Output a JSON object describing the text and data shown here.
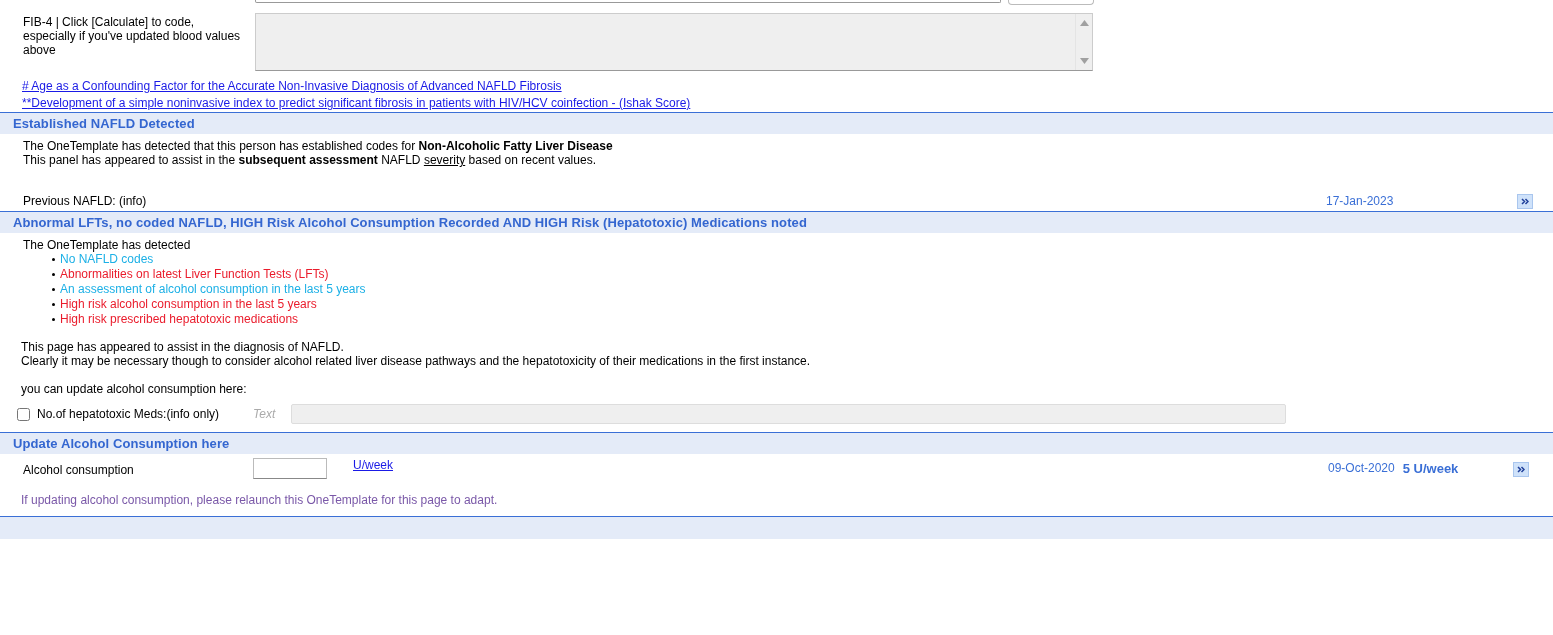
{
  "fib4": {
    "label": "FIB-4 | Click [Calculate] to code, especially if you've updated blood values above"
  },
  "references": [
    {
      "text": "# Age as a Confounding Factor for the Accurate Non-Invasive Diagnosis of Advanced NAFLD Fibrosis"
    },
    {
      "text": "**Development of a simple noninvasive index to predict significant fibrosis in patients with HIV/HCV coinfection - (Ishak Score)"
    }
  ],
  "established_nafld": {
    "title": "Established NAFLD Detected",
    "message": "The OneTemplate has detected that this person has established codes for **Non-Alcoholic Fatty Liver Disease**",
    "message_2": [
      {
        "text": "This panel has appeared to assist in the **subsequent assessment** NAFLD ",
        "underline": false
      },
      {
        "text": "severity",
        "underline": true
      },
      {
        "text": " based on recent values.",
        "underline": false
      }
    ],
    "previous": {
      "label": "Previous NAFLD: (info)",
      "date": "17-Jan-2023"
    }
  },
  "abnormal_lfts": {
    "title": "Abnormal LFTs, no coded NAFLD, HIGH Risk Alcohol Consumption Recorded AND HIGH Risk (Hepatotoxic) Medications noted",
    "intro": "The OneTemplate has detected",
    "findings": [
      {
        "text": "No NAFLD codes",
        "color": "#1cb0e6"
      },
      {
        "text": "Abnormalities on latest Liver Function Tests (LFTs)",
        "color": "#ea1c2c"
      },
      {
        "text": "An assessment of alcohol consumption in the last 5 years",
        "color": "#1cb0e6"
      },
      {
        "text": "High risk alcohol consumption in the last 5 years",
        "color": "#ea1c2c"
      },
      {
        "text": "High risk prescribed hepatotoxic medications",
        "color": "#ea1c2c"
      }
    ],
    "notes": [
      "This page has appeared to assist in the diagnosis of NAFLD.",
      "Clearly it may be necessary though to consider alcohol related liver disease pathways and the hepatotoxicity of their medications in the first instance."
    ],
    "update_prompt": "you can update alcohol consumption here:",
    "meds": {
      "label": "No.of hepatotoxic Meds:(info only)",
      "checked": false,
      "field_label": "Text"
    }
  },
  "alcohol": {
    "title": "Update Alcohol Consumption here",
    "label": "Alcohol consumption",
    "unit_link": "U/week",
    "last_date": "09-Oct-2020",
    "last_value": "5 U/week",
    "hint": "If updating alcohol consumption, please relaunch this OneTemplate for this page to adapt."
  }
}
